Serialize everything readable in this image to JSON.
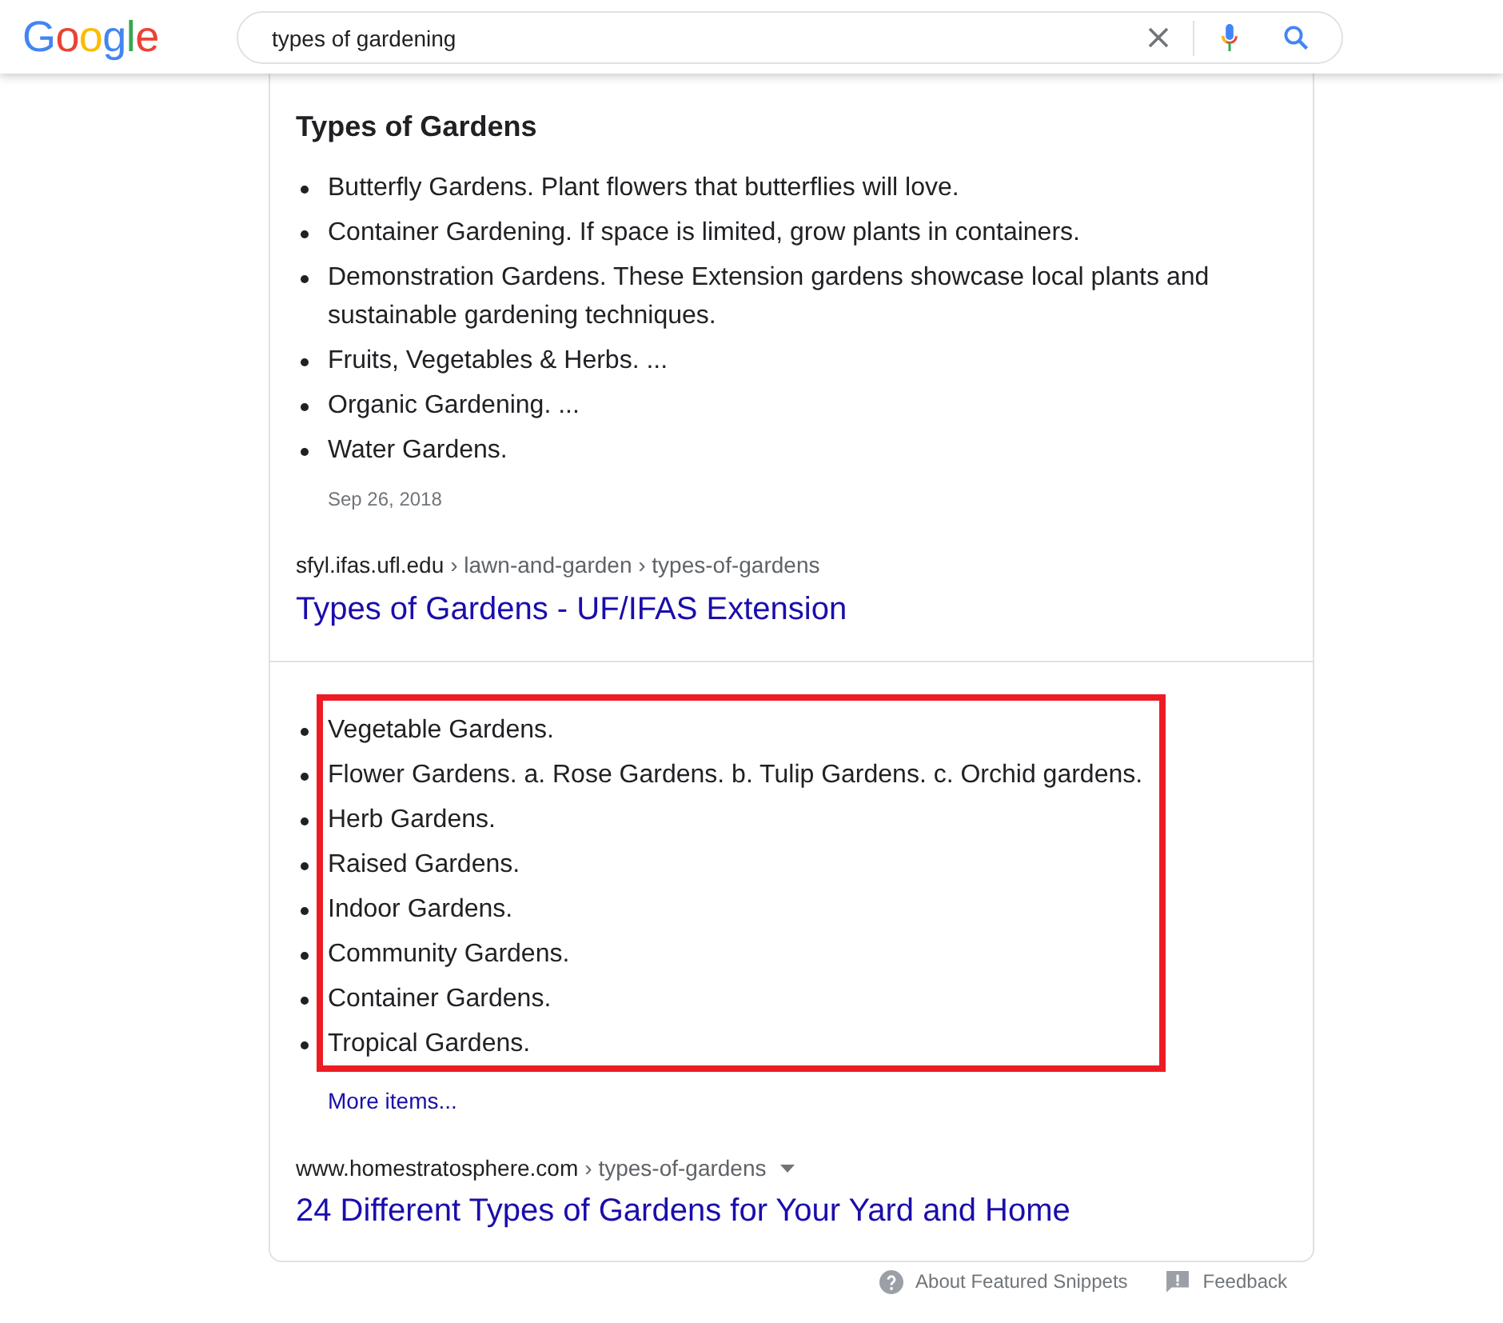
{
  "header": {
    "logo": "Google",
    "search": {
      "value": "types of gardening"
    }
  },
  "snippets": [
    {
      "heading": "Types of Gardens",
      "items": [
        "Butterfly Gardens. Plant flowers that butterflies will love.",
        "Container Gardening. If space is limited, grow plants in containers.",
        "Demonstration Gardens. These Extension gardens showcase local plants and sustainable gardening techniques.",
        "Fruits, Vegetables & Herbs. ...",
        "Organic Gardening. ...",
        "Water Gardens."
      ],
      "date": "Sep 26, 2018",
      "source": {
        "domain": "sfyl.ifas.ufl.edu",
        "path": "› lawn-and-garden › types-of-gardens",
        "title": "Types of Gardens - UF/IFAS Extension"
      }
    },
    {
      "items": [
        "Vegetable Gardens.",
        "Flower Gardens. a. Rose Gardens. b. Tulip Gardens. c. Orchid gardens.",
        "Herb Gardens.",
        "Raised Gardens.",
        "Indoor Gardens.",
        "Community Gardens.",
        "Container Gardens.",
        "Tropical Gardens."
      ],
      "highlighted": true,
      "more_link": "More items...",
      "source": {
        "domain": "www.homestratosphere.com",
        "path": "› types-of-gardens",
        "menu": true,
        "title": "24 Different Types of Gardens for Your Yard and Home"
      }
    }
  ],
  "footer": {
    "links": [
      {
        "kind": "help",
        "label": "About Featured Snippets"
      },
      {
        "kind": "feedback",
        "label": "Feedback"
      }
    ]
  }
}
